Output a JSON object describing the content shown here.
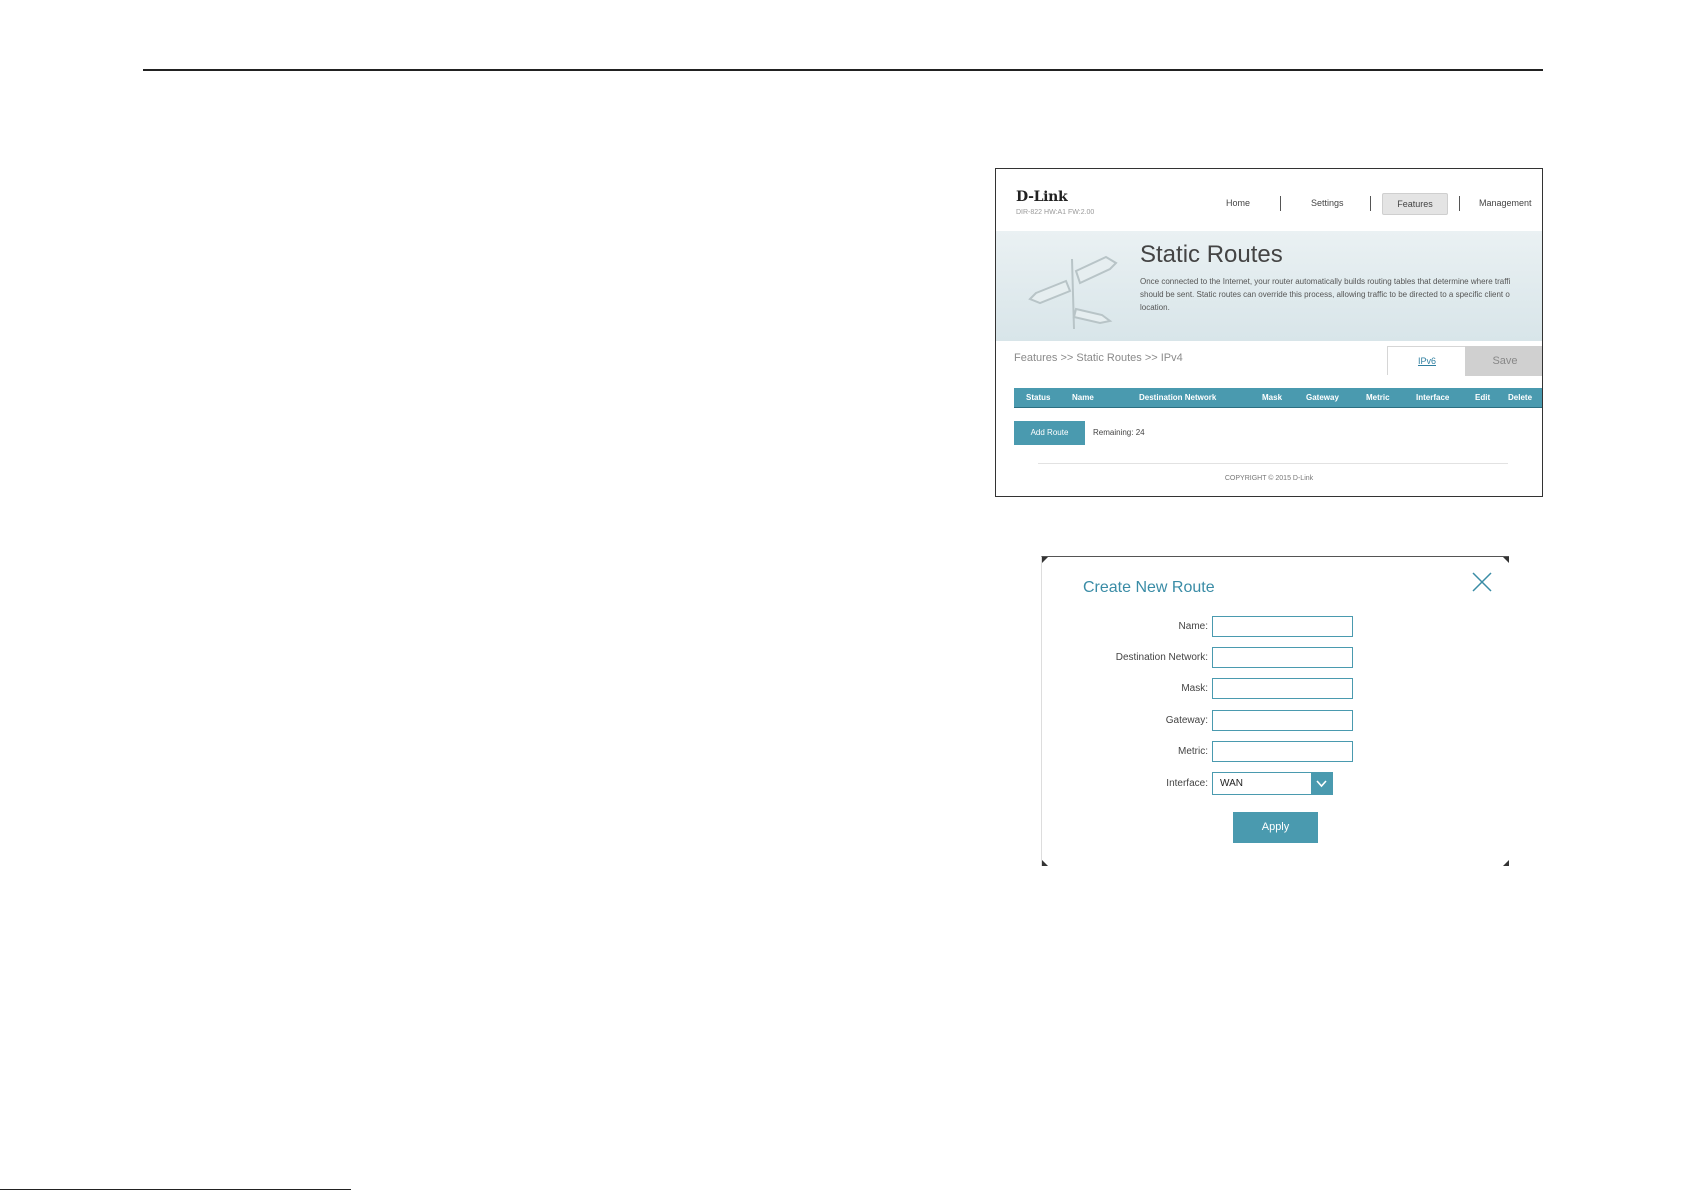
{
  "page": {
    "top_rule": true
  },
  "router_page": {
    "logo": "D-Link",
    "model": "DIR-822 HW:A1 FW:2.00",
    "nav": {
      "home": "Home",
      "settings": "Settings",
      "features": "Features",
      "management": "Management",
      "active": "Features"
    },
    "title": "Static Routes",
    "description": [
      "Once connected to the Internet, your router automatically builds routing tables that determine where traffi",
      "should be sent. Static routes can override this process, allowing traffic to be directed to a specific client o",
      "location."
    ],
    "breadcrumb": "Features >> Static Routes >> IPv4",
    "ipv6_tab": "IPv6",
    "save_label": "Save",
    "table_columns": [
      "Status",
      "Name",
      "Destination Network",
      "Mask",
      "Gateway",
      "Metric",
      "Interface",
      "Edit",
      "Delete"
    ],
    "add_route_label": "Add Route",
    "remaining": "Remaining: 24",
    "copyright": "COPYRIGHT © 2015 D-Link",
    "accent_color": "#4a9aaf"
  },
  "dialog": {
    "title": "Create New Route",
    "fields": {
      "name_label": "Name:",
      "name_value": "",
      "destination_label": "Destination Network:",
      "destination_value": "",
      "mask_label": "Mask:",
      "mask_value": "",
      "gateway_label": "Gateway:",
      "gateway_value": "",
      "metric_label": "Metric:",
      "metric_value": "",
      "interface_label": "Interface:",
      "interface_value": "WAN"
    },
    "apply_label": "Apply",
    "close_icon": "close-icon"
  }
}
